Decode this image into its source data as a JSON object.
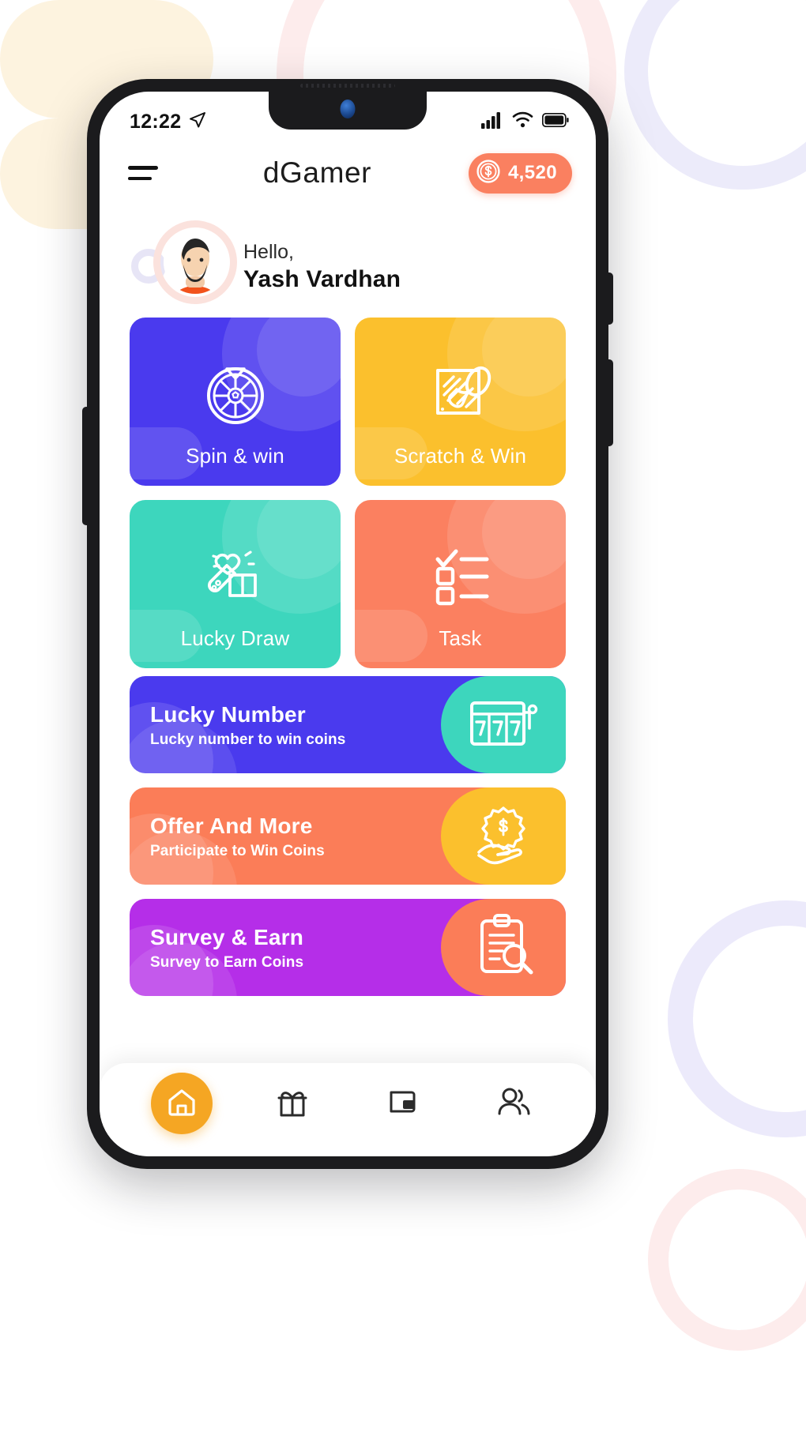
{
  "status_bar": {
    "time": "12:22",
    "location_icon": "location-arrow-icon",
    "signal_icon": "signal-bars-icon",
    "wifi_icon": "wifi-icon",
    "battery_icon": "battery-full-icon"
  },
  "header": {
    "menu_icon": "hamburger-menu-icon",
    "title": "dGamer",
    "coin_icon": "dollar-coin-icon",
    "coin_amount": "4,520",
    "coin_badge_color": "#fa8060"
  },
  "greeting": {
    "hello": "Hello,",
    "name": "Yash Vardhan",
    "avatar_icon": "user-avatar-icon"
  },
  "tiles": [
    {
      "label": "Spin & win",
      "icon": "spin-wheel-icon",
      "color": "#4a3aee"
    },
    {
      "label": "Scratch & Win",
      "icon": "scratch-card-icon",
      "color": "#fbc02d"
    },
    {
      "label": "Lucky Draw",
      "icon": "gift-wand-icon",
      "color": "#3dd6bd"
    },
    {
      "label": "Task",
      "icon": "checklist-icon",
      "color": "#fb8060"
    }
  ],
  "banners": [
    {
      "title": "Lucky Number",
      "subtitle": "Lucky number to win coins",
      "color": "#4a3aee",
      "art_color": "#3dd6bd",
      "icon": "slot-machine-777-icon"
    },
    {
      "title": "Offer And More",
      "subtitle": "Participate to Win Coins",
      "color": "#fb7d58",
      "art_color": "#fbc02d",
      "icon": "hand-coin-badge-icon"
    },
    {
      "title": "Survey & Earn",
      "subtitle": "Survey to Earn Coins",
      "color": "#b52ee8",
      "art_color": "#fb7d58",
      "icon": "clipboard-search-icon"
    }
  ],
  "bottom_nav": [
    {
      "icon": "home-icon",
      "active": true
    },
    {
      "icon": "gift-icon",
      "active": false
    },
    {
      "icon": "wallet-icon",
      "active": false
    },
    {
      "icon": "people-icon",
      "active": false
    }
  ]
}
